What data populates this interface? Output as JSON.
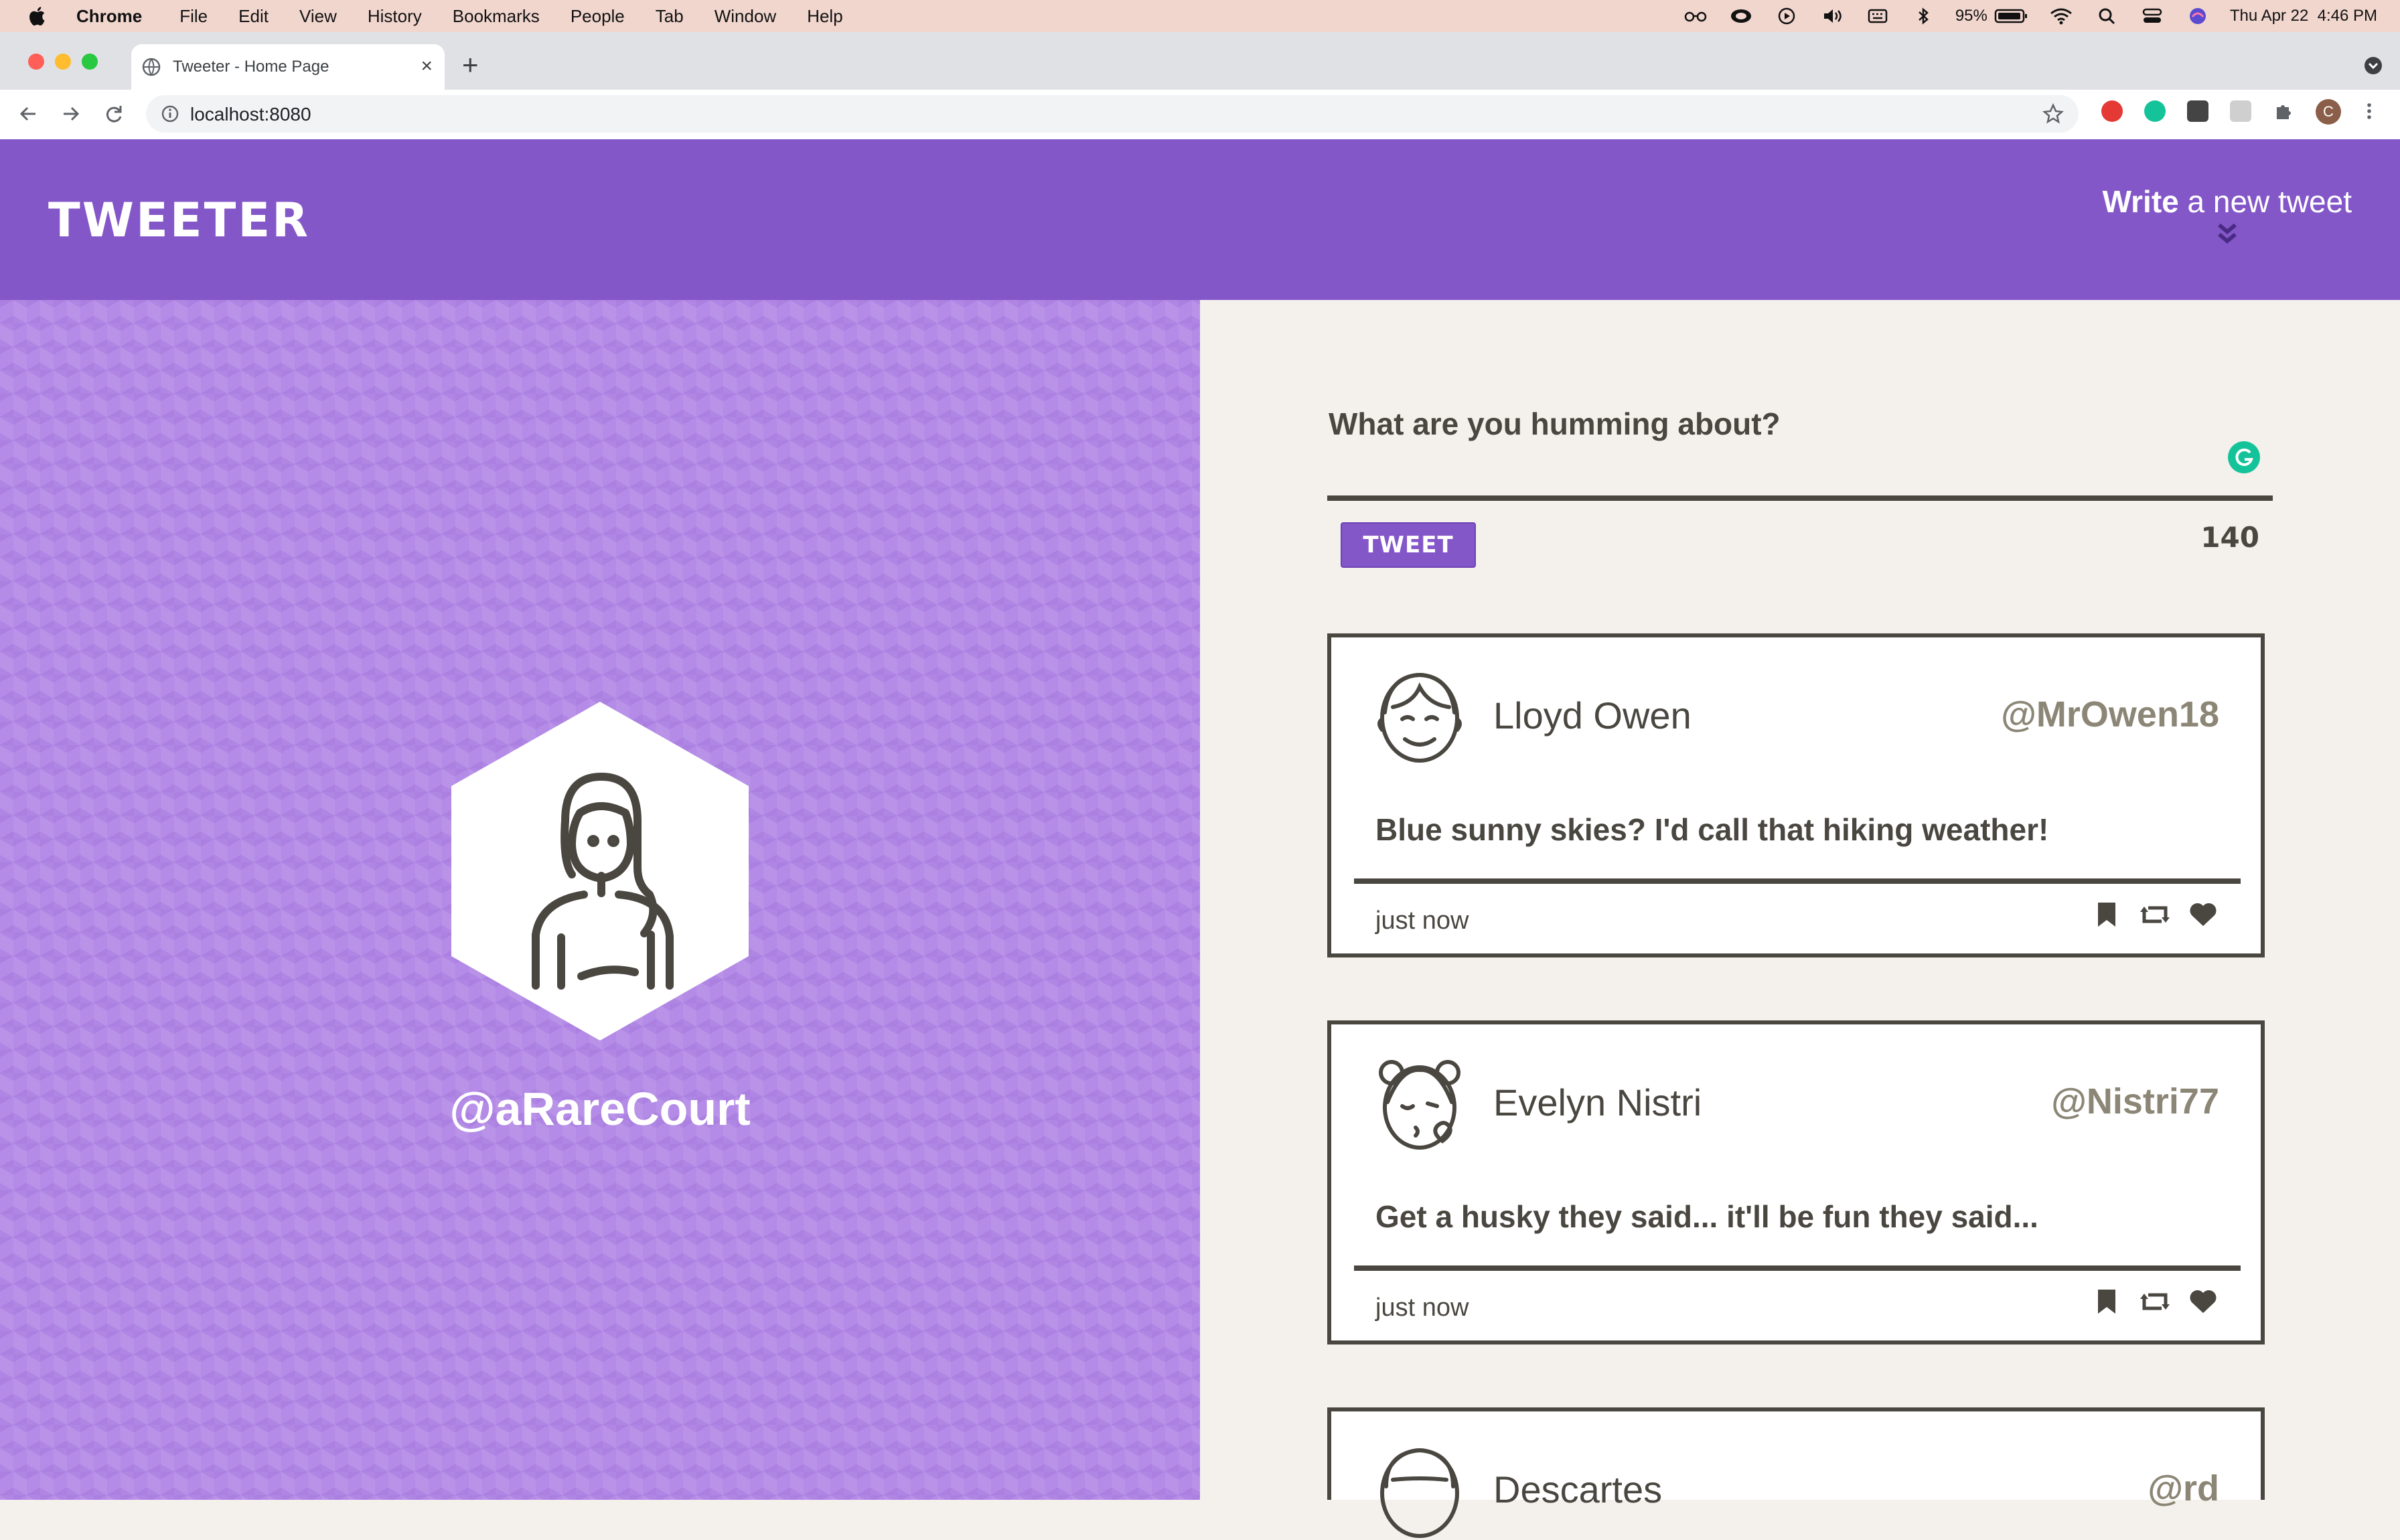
{
  "menubar": {
    "app": "Chrome",
    "items": [
      "File",
      "Edit",
      "View",
      "History",
      "Bookmarks",
      "People",
      "Tab",
      "Window",
      "Help"
    ],
    "battery": "95%",
    "datetime": "Thu Apr 22  4:46 PM"
  },
  "browser": {
    "tab_title": "Tweeter - Home Page",
    "url": "localhost:8080",
    "profile_initial": "C"
  },
  "header": {
    "logo": "TWEETER",
    "write_bold": "Write",
    "write_rest": " a new tweet"
  },
  "profile": {
    "handle": "@aRareCourt"
  },
  "composer": {
    "prompt": "What are you humming about?",
    "button": "TWEET",
    "counter": "140"
  },
  "tweets": [
    {
      "name": "Lloyd Owen",
      "handle": "@MrOwen18",
      "content": "Blue sunny skies? I'd call that hiking weather!",
      "time": "just now"
    },
    {
      "name": "Evelyn Nistri",
      "handle": "@Nistri77",
      "content": "Get a husky they said... it'll be fun they said...",
      "time": "just now"
    },
    {
      "name": "Descartes",
      "handle": "@rd",
      "content": "",
      "time": ""
    }
  ],
  "colors": {
    "brand_purple": "#8457c9",
    "panel_purple": "#b48be6",
    "ink": "#4a4741",
    "handle_gray": "#8c8676",
    "feed_bg": "#f4f1ec"
  }
}
